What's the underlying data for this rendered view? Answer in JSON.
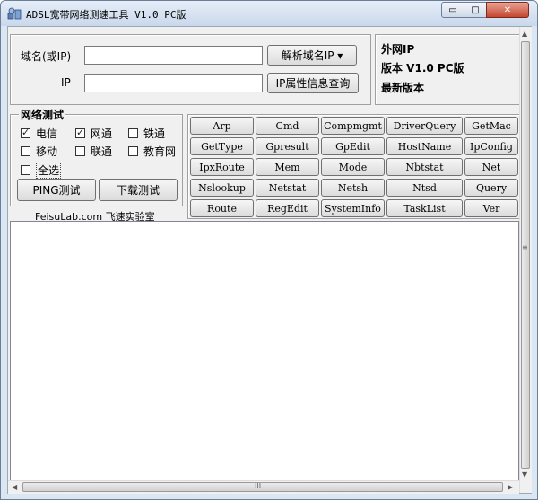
{
  "window": {
    "title": "ADSL宽带网络测速工具 V1.0 PC版",
    "controls": {
      "minimize": "▭",
      "maximize": "□",
      "close": "✕"
    }
  },
  "resolve": {
    "domain_label": "域名(或IP)",
    "domain_value": "",
    "resolve_button": "解析域名IP ▾",
    "ip_label": "IP",
    "ip_value": "",
    "ip_info_button": "IP属性信息查询"
  },
  "info_panel": {
    "external_ip": "外网IP",
    "version": "版本 V1.0 PC版",
    "latest": "最新版本"
  },
  "network_test": {
    "title": "网络测试",
    "options": [
      {
        "label": "电信",
        "checked": true
      },
      {
        "label": "网通",
        "checked": true
      },
      {
        "label": "铁通",
        "checked": false
      },
      {
        "label": "移动",
        "checked": false
      },
      {
        "label": "联通",
        "checked": false
      },
      {
        "label": "教育网",
        "checked": false
      }
    ],
    "select_all": {
      "label": "全选",
      "checked": false
    },
    "ping_button": "PING测试",
    "download_button": "下载测试",
    "credit": "FeisuLab.com 飞速实验室"
  },
  "commands": [
    [
      "Arp",
      "Cmd",
      "Compmgmt",
      "DriverQuery",
      "GetMac"
    ],
    [
      "GetType",
      "Gpresult",
      "GpEdit",
      "HostName",
      "IpConfig"
    ],
    [
      "IpxRoute",
      "Mem",
      "Mode",
      "Nbtstat",
      "Net"
    ],
    [
      "Nslookup",
      "Netstat",
      "Netsh",
      "Ntsd",
      "Query"
    ],
    [
      "Route",
      "RegEdit",
      "SystemInfo",
      "TaskList",
      "Ver"
    ]
  ],
  "output": {
    "text": ""
  },
  "scrollbar": {
    "grip_v": "≡",
    "grip_h": "III"
  }
}
